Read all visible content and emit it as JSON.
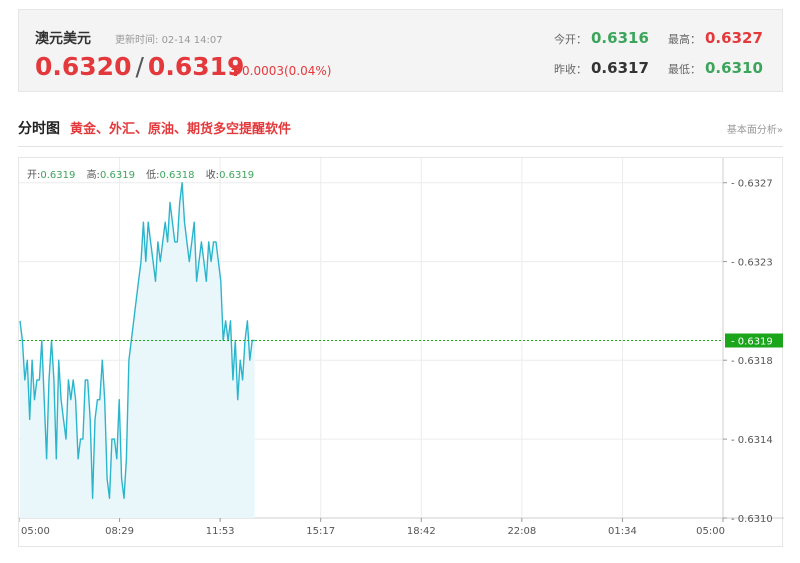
{
  "quote": {
    "name": "澳元美元",
    "update_label": "更新时间:",
    "update_time": "02-14 14:07",
    "bid": "0.6320",
    "ask": "0.6319",
    "change": "0.0003(0.04%)",
    "open_label": "今开：",
    "open": "0.6316",
    "high_label": "最高：",
    "high": "0.6327",
    "prev_close_label": "昨收：",
    "prev_close": "0.6317",
    "low_label": "最低：",
    "low": "0.6310",
    "up_arrow_icon": "arrow-up-icon",
    "colors": {
      "up": "#e4393c",
      "down": "#3ca55c"
    }
  },
  "section": {
    "title": "分时图",
    "ad_text": "黄金、外汇、原油、期货多空提醒软件",
    "link": "基本面分析»"
  },
  "ohlc": {
    "open_label": "开:",
    "open": "0.6319",
    "high_label": "高:",
    "high": "0.6319",
    "low_label": "低:",
    "low": "0.6318",
    "close_label": "收:",
    "close": "0.6319"
  },
  "chart_data": {
    "type": "area",
    "x_ticks": [
      "05:00",
      "08:29",
      "11:53",
      "15:17",
      "18:42",
      "22:08",
      "01:34",
      "05:00"
    ],
    "y_ticks": [
      "0.6327",
      "0.6323",
      "0.6318",
      "0.6314",
      "0.6310"
    ],
    "ylim": [
      0.631,
      0.6328
    ],
    "current_price": "0.6319",
    "grid": true,
    "line_color": "#2bb5cc",
    "fill_color": "#eaf7fa",
    "marker_color": "#1aa51a",
    "time_axis_slots": 24,
    "series": [
      {
        "values": [
          0.632,
          0.6319,
          0.6317,
          0.6318,
          0.6315,
          0.6318,
          0.6316,
          0.6317,
          0.6317,
          0.6319,
          0.6316,
          0.6313,
          0.6317,
          0.6319,
          0.6317,
          0.6313,
          0.6318,
          0.6316,
          0.6315,
          0.6314,
          0.6317,
          0.6316,
          0.6317,
          0.6316,
          0.6313,
          0.6314,
          0.6314,
          0.6317,
          0.6317,
          0.6315,
          0.6311,
          0.6315,
          0.6316,
          0.6316,
          0.6318,
          0.6316,
          0.6312,
          0.6311,
          0.6314,
          0.6314,
          0.6313,
          0.6316,
          0.6312,
          0.6311,
          0.6313,
          0.6318,
          0.6319,
          0.632,
          0.6321,
          0.6322,
          0.6323,
          0.6325,
          0.6323,
          0.6325,
          0.6324,
          0.6323,
          0.6322,
          0.6324,
          0.6323,
          0.6324,
          0.6325,
          0.6324,
          0.6326,
          0.6325,
          0.6324,
          0.6324,
          0.6326,
          0.6327,
          0.6325,
          0.6324,
          0.6323,
          0.6324,
          0.6325,
          0.6322,
          0.6323,
          0.6324,
          0.6323,
          0.6322,
          0.6324,
          0.6323,
          0.6324,
          0.6324,
          0.6323,
          0.6322,
          0.6319,
          0.632,
          0.6319,
          0.632,
          0.6317,
          0.6319,
          0.6316,
          0.6318,
          0.6317,
          0.6319,
          0.632,
          0.6318,
          0.6319,
          0.6319
        ]
      }
    ]
  }
}
